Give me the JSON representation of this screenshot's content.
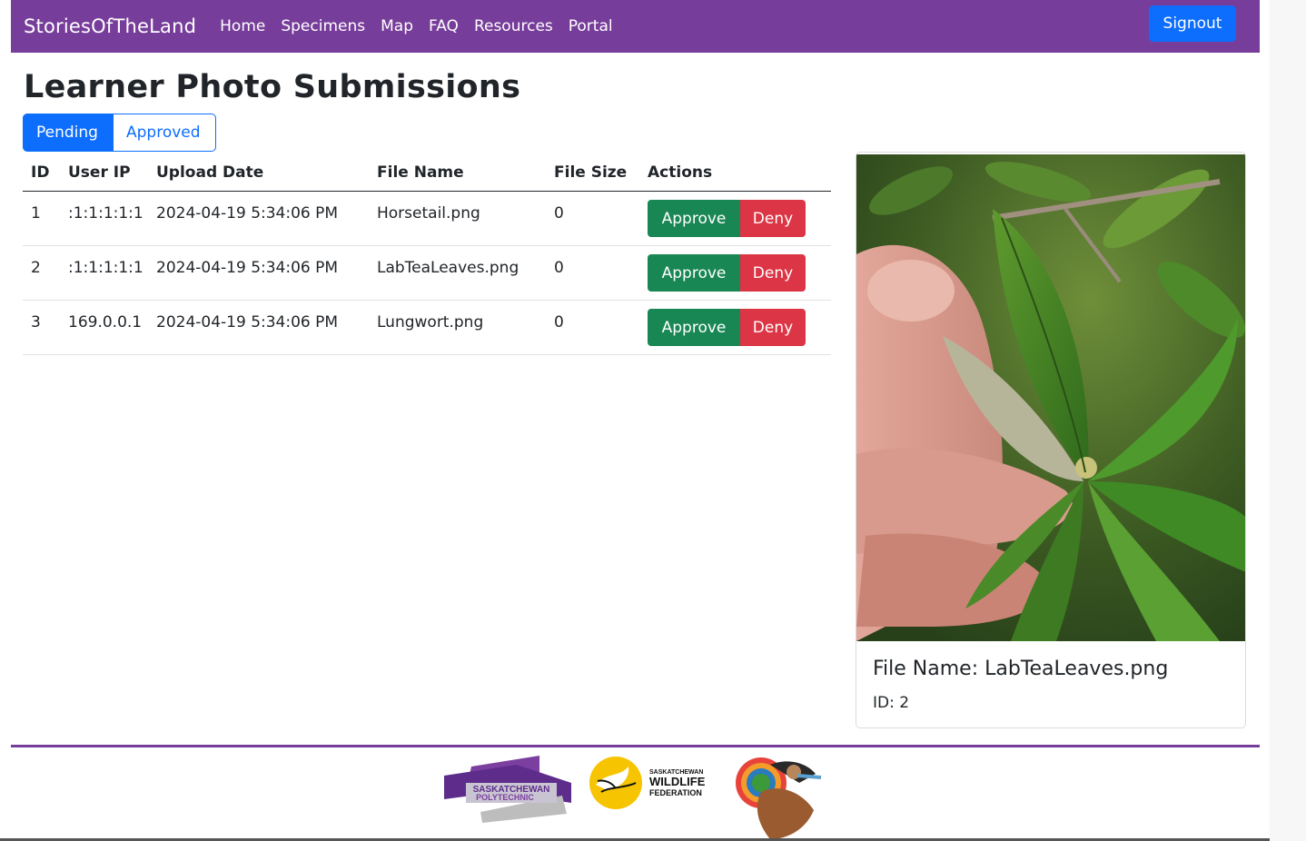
{
  "navbar": {
    "brand": "StoriesOfTheLand",
    "links": [
      "Home",
      "Specimens",
      "Map",
      "FAQ",
      "Resources",
      "Portal"
    ],
    "signout_label": "Signout"
  },
  "page": {
    "title": "Learner Photo Submissions"
  },
  "tabs": [
    {
      "label": "Pending",
      "active": true
    },
    {
      "label": "Approved",
      "active": false
    }
  ],
  "table": {
    "headers": [
      "ID",
      "User IP",
      "Upload Date",
      "File Name",
      "File Size",
      "Actions"
    ],
    "rows": [
      {
        "id": "1",
        "ip": ":1:1:1:1:1",
        "date": "2024-04-19 5:34:06 PM",
        "file": "Horsetail.png",
        "size": "0"
      },
      {
        "id": "2",
        "ip": ":1:1:1:1:1",
        "date": "2024-04-19 5:34:06 PM",
        "file": "LabTeaLeaves.png",
        "size": "0"
      },
      {
        "id": "3",
        "ip": "169.0.0.1",
        "date": "2024-04-19 5:34:06 PM",
        "file": "Lungwort.png",
        "size": "0"
      }
    ],
    "approve_label": "Approve",
    "deny_label": "Deny"
  },
  "preview": {
    "title": "File Name: LabTeaLeaves.png",
    "id_text": "ID: 2"
  },
  "footer": {
    "logos": [
      {
        "text": [
          "SASKATCHEWAN",
          "POLYTECHNIC"
        ]
      },
      {
        "text": [
          "SASKATCHEWAN",
          "WILDLIFE",
          "FEDERATION"
        ]
      },
      {
        "text": []
      }
    ]
  },
  "colors": {
    "navbar": "#773d9a",
    "primary": "#0d6efd",
    "approve": "#198754",
    "deny": "#dc3545"
  }
}
